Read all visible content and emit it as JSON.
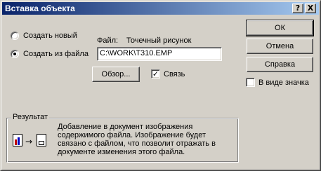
{
  "window": {
    "title": "Вставка объекта",
    "help_glyph": "?",
    "close_glyph": "X"
  },
  "options": {
    "create_new_label": "Создать новый",
    "create_from_file_label": "Создать из файла",
    "selected": "create_from_file"
  },
  "file": {
    "label": "Файл:",
    "type": "Точечный рисунок",
    "path_value": "C:\\WORK\\T310.EMP"
  },
  "buttons": {
    "ok": "ОК",
    "cancel": "Отмена",
    "help": "Справка",
    "browse": "Обзор..."
  },
  "link_checkbox": {
    "label": "Связь",
    "checked": true
  },
  "as_icon_checkbox": {
    "label": "В виде значка",
    "checked": false
  },
  "result": {
    "title": "Результат",
    "text": "Добавление в документ изображения содержимого файла.  Изображение будет связано с файлом, что позволит отражать в документе изменения этого файла."
  },
  "colors": {
    "face": "#d4d0c8",
    "title_start": "#0a246a",
    "title_end": "#a6caf0"
  }
}
